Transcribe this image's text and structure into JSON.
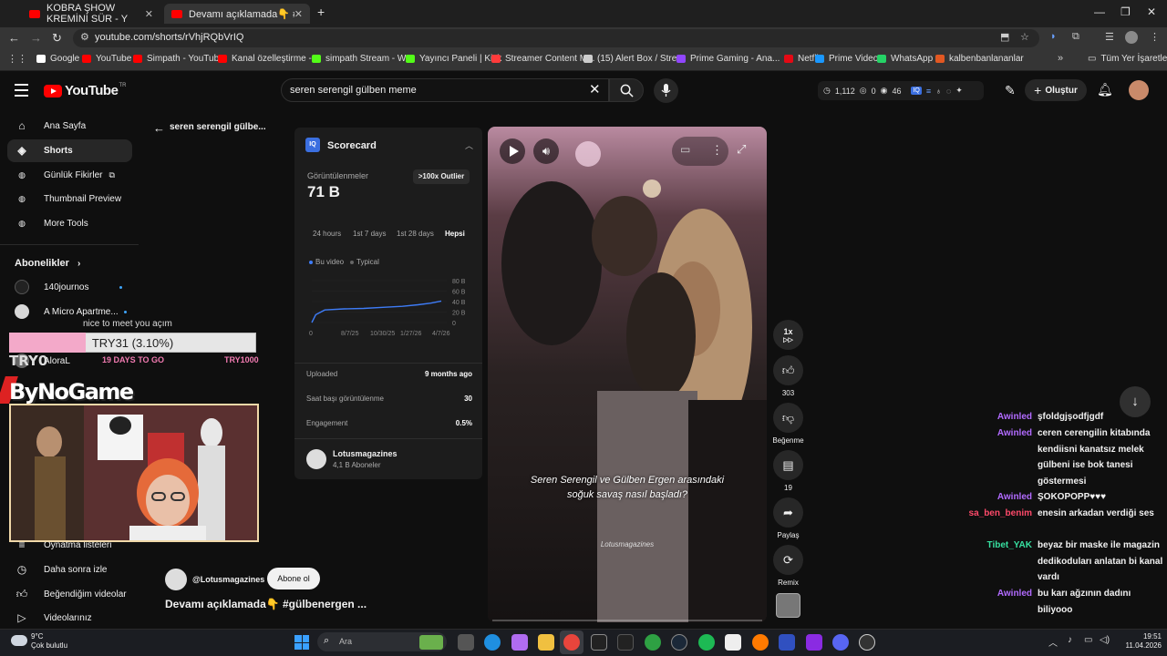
{
  "browser": {
    "tabs": [
      {
        "label": "KOBRA ŞHOW KREMİNİ SÜR - Y"
      },
      {
        "label": "Devamı açıklamada👇 #gülben"
      }
    ],
    "url": "youtube.com/shorts/rVhjRQbVrIQ",
    "bookmarks": [
      {
        "label": "Google",
        "color": "#ffffff"
      },
      {
        "label": "YouTube",
        "color": "#ff0000"
      },
      {
        "label": "Simpath - YouTube",
        "color": "#ff0000"
      },
      {
        "label": "Kanal özelleştirme -...",
        "color": "#ff0000"
      },
      {
        "label": "simpath Stream - W...",
        "color": "#53fc18"
      },
      {
        "label": "Yayıncı Paneli | Kick",
        "color": "#53fc18"
      },
      {
        "label": "Streamer Content M...",
        "color": "#ff3b3b"
      },
      {
        "label": "(15) Alert Box / Stre...",
        "color": "#cccccc"
      },
      {
        "label": "Prime Gaming - Ana...",
        "color": "#9146ff"
      },
      {
        "label": "Netflix",
        "color": "#e50914"
      },
      {
        "label": "Prime Video",
        "color": "#1a98ff"
      },
      {
        "label": "WhatsApp",
        "color": "#25d366"
      },
      {
        "label": "kalbenbanlananlar",
        "color": "#e25822"
      }
    ],
    "all_bookmarks": "Tüm Yer İşaretleri"
  },
  "youtube": {
    "logo": "YouTube",
    "logo_country": "TR",
    "search_value": "seren serengil gülben meme",
    "stats": {
      "a": "1,112",
      "b": "0",
      "c": "46"
    },
    "create_label": "Oluştur"
  },
  "sidebar": {
    "items": [
      {
        "label": "Ana Sayfa",
        "icon": "home-icon"
      },
      {
        "label": "Shorts",
        "icon": "shorts-icon"
      },
      {
        "label": "Günlük Fikirler",
        "icon": "ideas-icon"
      },
      {
        "label": "Thumbnail Preview",
        "icon": "preview-icon"
      },
      {
        "label": "More Tools",
        "icon": "tools-icon"
      }
    ],
    "subs_header": "Abonelikler",
    "subs": [
      {
        "label": "140journos"
      },
      {
        "label": "A Micro Apartme..."
      },
      {
        "label": "AloraL"
      }
    ],
    "bottom": [
      {
        "label": "Oynatma listeleri"
      },
      {
        "label": "Daha sonra izle"
      },
      {
        "label": "Beğendiğim videolar"
      },
      {
        "label": "Videolarınız"
      }
    ]
  },
  "overlay": {
    "greeting": "nice to meet you açım",
    "goal_text": "TRY31 (3.10%)",
    "goal_fraction": 0.031,
    "goal_min": "TRY0",
    "goal_days": "19 DAYS TO GO",
    "goal_max": "TRY1000",
    "brand": "ByNoGame"
  },
  "shorts": {
    "page_title": "seren serengil gülbe...",
    "scorecard": {
      "title": "Scorecard",
      "views_label": "Görüntülenmeler",
      "views_value": "71 B",
      "outlier": ">100x Outlier",
      "ranges": [
        "24 hours",
        "1st 7 days",
        "1st 28 days",
        "Hepsi"
      ],
      "legend_this": "Bu video",
      "legend_typical": "Typical",
      "rows": [
        {
          "label": "Uploaded",
          "value": "9 months ago"
        },
        {
          "label": "Saat başı görüntülenme",
          "value": "30"
        },
        {
          "label": "Engagement",
          "value": "0.5%"
        }
      ],
      "channel_name": "Lotusmagazines",
      "channel_subs": "4,1 B Aboneler"
    },
    "video": {
      "caption_line1": "Seren Serengil ve Gülben Ergen arasındaki",
      "caption_line2": "soğuk savaş nasıl başladı?",
      "watermark": "Lotusmagazines"
    },
    "actions": {
      "speed": "1x",
      "likes": "303",
      "dislike_label": "Beğenme",
      "comments": "19",
      "share_label": "Paylaş",
      "remix_label": "Remix"
    },
    "below": {
      "channel": "@Lotusmagazines",
      "subscribe": "Abone ol",
      "title": "Devamı açıklamada👇  #gülbenergen ..."
    }
  },
  "chart_data": {
    "type": "line",
    "x_ticks": [
      "0",
      "8/7/25",
      "10/30/25",
      "1/27/26",
      "4/7/26"
    ],
    "y_ticks": [
      "80 B",
      "60 B",
      "40 B",
      "20 B",
      "0"
    ],
    "series": [
      {
        "name": "Bu video",
        "color": "#3e7cf7",
        "points": [
          [
            0,
            0
          ],
          [
            0.03,
            15
          ],
          [
            0.1,
            24
          ],
          [
            0.25,
            26
          ],
          [
            0.4,
            27
          ],
          [
            0.55,
            29
          ],
          [
            0.7,
            31
          ],
          [
            0.82,
            34
          ],
          [
            0.92,
            37
          ],
          [
            1.0,
            41
          ]
        ]
      }
    ]
  },
  "chat": [
    {
      "user": "Awinled",
      "color": "#b26bff",
      "msg": "şfoldgjşodfjgdf"
    },
    {
      "user": "Awinled",
      "color": "#b26bff",
      "msg": "ceren cerengilin kitabında kendiisni kanatsız melek gülbeni ise bok tanesi göstermesi"
    },
    {
      "user": "Awinled",
      "color": "#b26bff",
      "msg": "ŞOKOPOPP♥♥♥"
    },
    {
      "user": "sa_ben_benim",
      "color": "#ff4a6a",
      "msg": "enesin arkadan verdiği ses"
    },
    {
      "user": "Tibet_YAK",
      "color": "#37e0a0",
      "msg": "beyaz bir maske ile magazin dedikoduları anlatan bi kanal vardı"
    },
    {
      "user": "Awinled",
      "color": "#b26bff",
      "msg": "bu karı ağzının dadını biliyooo"
    }
  ],
  "taskbar": {
    "temp": "9°C",
    "weather": "Çok bulutlu",
    "search": "Ara",
    "time": "19:51",
    "date": "11.04.2026"
  }
}
